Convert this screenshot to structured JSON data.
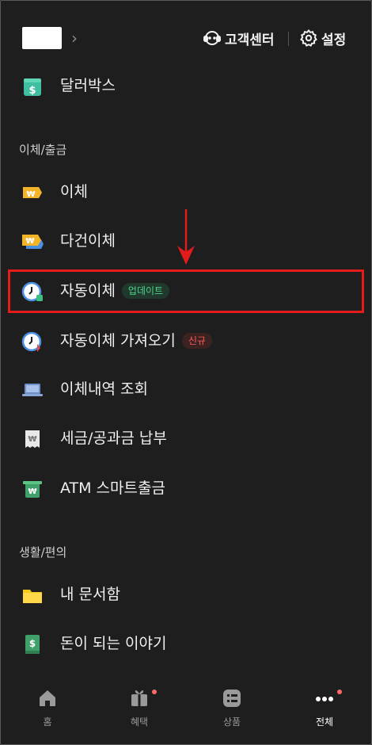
{
  "header": {
    "support_label": "고객센터",
    "settings_label": "설정",
    "chevron": "›"
  },
  "menu_top": [
    {
      "label": "달러박스",
      "icon": "dollar-gift-icon"
    }
  ],
  "sections": [
    {
      "title": "이체/출금",
      "items": [
        {
          "label": "이체",
          "icon": "transfer-card-icon"
        },
        {
          "label": "다건이체",
          "icon": "multi-transfer-icon"
        },
        {
          "label": "자동이체",
          "icon": "auto-transfer-clock-icon",
          "badge": "업데이트"
        },
        {
          "label": "자동이체 가져오기",
          "icon": "import-auto-transfer-icon",
          "badge": "신규"
        },
        {
          "label": "이체내역 조회",
          "icon": "laptop-icon"
        },
        {
          "label": "세금/공과금 납부",
          "icon": "receipt-icon"
        },
        {
          "label": "ATM 스마트출금",
          "icon": "atm-cash-icon"
        }
      ]
    },
    {
      "title": "생활/편의",
      "items": [
        {
          "label": "내 문서함",
          "icon": "folder-icon"
        },
        {
          "label": "돈이 되는 이야기",
          "icon": "money-book-icon"
        }
      ]
    }
  ],
  "tabbar": [
    {
      "label": "홈",
      "icon": "home-icon",
      "active": false
    },
    {
      "label": "혜택",
      "icon": "gift-icon",
      "active": false,
      "dot": true
    },
    {
      "label": "상품",
      "icon": "products-icon",
      "active": false
    },
    {
      "label": "전체",
      "icon": "more-icon",
      "active": true,
      "dot": true
    }
  ],
  "colors": {
    "background": "#1e1e1e",
    "highlight": "#e31b1b",
    "badge_update": "#52d38b",
    "badge_new": "#ff5a5a",
    "notification_dot": "#ff6b6b"
  }
}
